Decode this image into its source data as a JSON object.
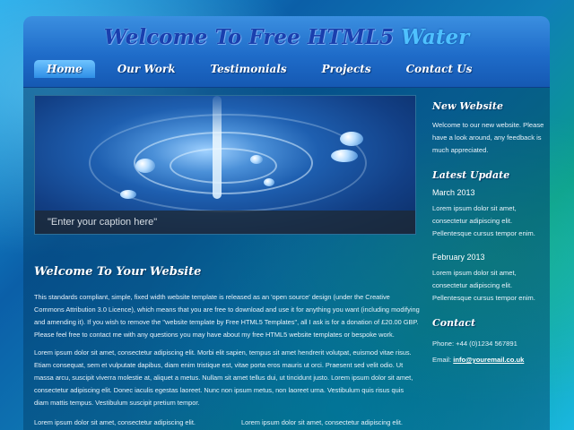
{
  "header": {
    "logo_main": "Welcome To Free HTML5",
    "logo_accent": "Water"
  },
  "menu": [
    {
      "label": "Home",
      "selected": true
    },
    {
      "label": "Our Work",
      "selected": false
    },
    {
      "label": "Testimonials",
      "selected": false
    },
    {
      "label": "Projects",
      "selected": false
    },
    {
      "label": "Contact Us",
      "selected": false
    }
  ],
  "slideshow": {
    "caption": "\"Enter your caption here\""
  },
  "main": {
    "heading": "Welcome To Your Website",
    "paragraph1": "This standards compliant, simple, fixed width website template is released as an 'open source' design (under the Creative Commons Attribution 3.0 Licence), which means that you are free to download and use it for anything you want (including modifying and amending it). If you wish to remove the \"website template by Free HTML5 Templates\", all I ask is for a donation of £20.00 GBP. Please feel free to contact me with any questions you may have about my free HTML5 website templates or bespoke work.",
    "paragraph2": "Lorem ipsum dolor sit amet, consectetur adipiscing elit. Morbi elit sapien, tempus sit amet hendrerit volutpat, euismod vitae risus. Etiam consequat, sem et vulputate dapibus, diam enim tristique est, vitae porta eros mauris ut orci. Praesent sed velit odio. Ut massa arcu, suscipit viverra molestie at, aliquet a metus. Nullam sit amet tellus dui, ut tincidunt justo. Lorem ipsum dolor sit amet, consectetur adipiscing elit. Donec iaculis egestas laoreet. Nunc non ipsum metus, non laoreet urna. Vestibulum quis risus quis diam mattis tempus. Vestibulum suscipit pretium tempor.",
    "col_left": "Lorem ipsum dolor sit amet, consectetur adipiscing elit.",
    "col_right": "Lorem ipsum dolor sit amet, consectetur adipiscing elit."
  },
  "sidebar": {
    "new_website_heading": "New Website",
    "new_website_text": "Welcome to our new website. Please have a look around, any feedback is much appreciated.",
    "latest_update_heading": "Latest Update",
    "update1_date": "March 2013",
    "update1_text": "Lorem ipsum dolor sit amet, consectetur adipiscing elit. Pellentesque cursus tempor enim.",
    "update2_date": "February 2013",
    "update2_text": "Lorem ipsum dolor sit amet, consectetur adipiscing elit. Pellentesque cursus tempor enim.",
    "contact_heading": "Contact",
    "phone": "Phone: +44 (0)1234 567891",
    "email_label": "Email:",
    "email": "info@youremail.co.uk"
  },
  "colors": {
    "banner": "#1f6cc9",
    "menu_selected": "#2e8ee6",
    "logo_dark": "#1a3fae",
    "logo_accent": "#4fc1ff"
  }
}
